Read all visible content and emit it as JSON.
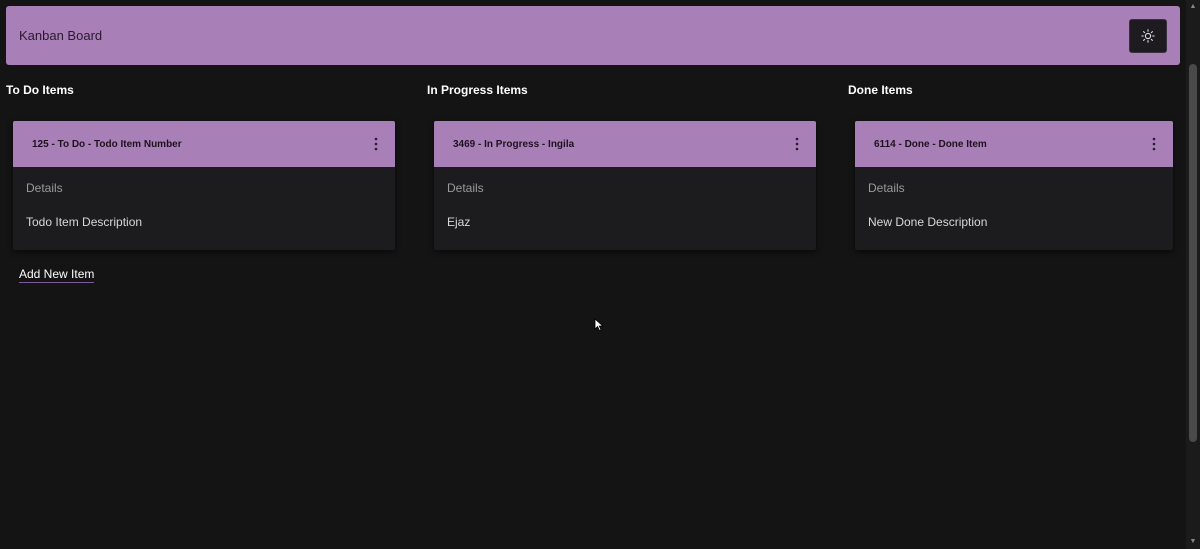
{
  "header": {
    "title": "Kanban Board",
    "theme_icon": "sun-icon"
  },
  "columns": [
    {
      "title": "To Do Items",
      "card": {
        "title": "125 - To Do - Todo Item Number",
        "details_label": "Details",
        "description": "Todo Item Description"
      }
    },
    {
      "title": "In Progress Items",
      "card": {
        "title": "3469 - In Progress - Ingila",
        "details_label": "Details",
        "description": "Ejaz"
      }
    },
    {
      "title": "Done Items",
      "card": {
        "title": "6114 - Done - Done Item",
        "details_label": "Details",
        "description": "New Done Description"
      }
    }
  ],
  "add_item_label": "Add New Item",
  "colors": {
    "accent": "#a97fb7",
    "background": "#141414",
    "card": "#1c1b1d"
  }
}
